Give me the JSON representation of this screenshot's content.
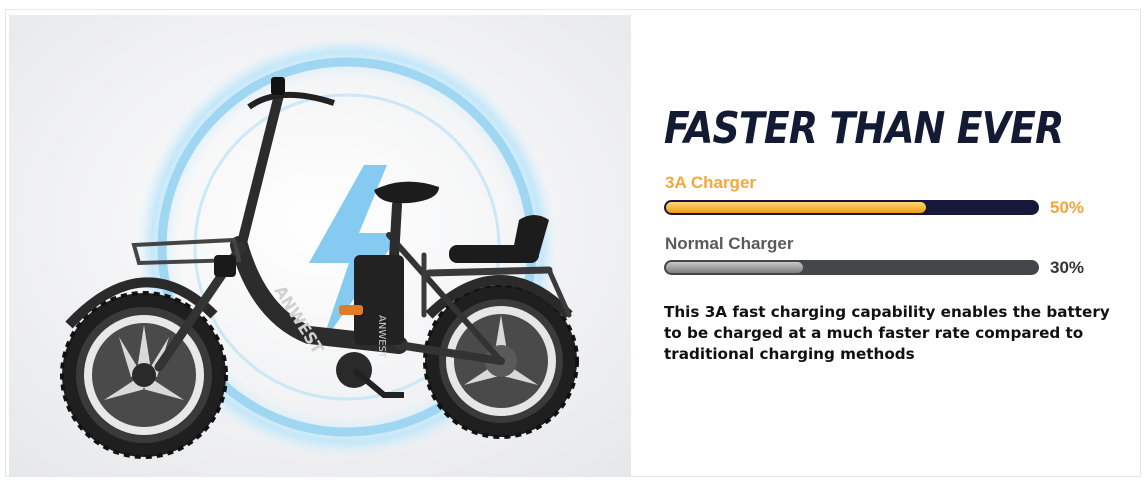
{
  "product_image": {
    "subject": "folding fat-tire electric bike on light background with blue lightning circle",
    "brand_mark": "ANWEST",
    "colors": {
      "background": "#f4f5f7",
      "circle": "#a7d8f3",
      "bike": "#2b2b2b"
    }
  },
  "headline": "FASTER THAN EVER",
  "comparison": [
    {
      "label": "3A Charger",
      "percent": 50,
      "percent_label": "50%",
      "fill_fraction": 0.7,
      "color": "#f7b73e",
      "track_color": "#17173a"
    },
    {
      "label": "Normal Charger",
      "percent": 30,
      "percent_label": "30%",
      "fill_fraction": 0.37,
      "color": "#9b9b9b",
      "track_color": "#444649"
    }
  ],
  "description": "This 3A fast charging capability enables the battery to be charged at a much faster rate compared to traditional charging methods"
}
